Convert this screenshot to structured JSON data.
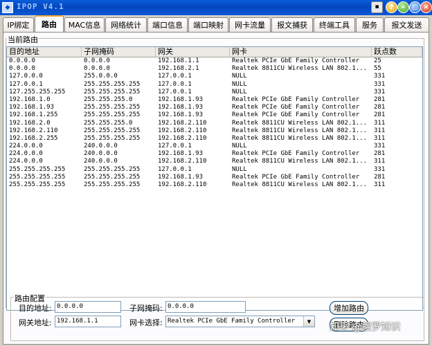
{
  "window": {
    "title": "IPOP V4.1",
    "help_glyph": "?",
    "min_glyph": "–",
    "max_glyph": "□",
    "close_glyph": "×",
    "menu_glyph": "▪"
  },
  "tabs": [
    {
      "label": "IP绑定",
      "active": false
    },
    {
      "label": "路由",
      "active": true
    },
    {
      "label": "MAC信息",
      "active": false
    },
    {
      "label": "网络统计",
      "active": false
    },
    {
      "label": "端口信息",
      "active": false
    },
    {
      "label": "端口映射",
      "active": false
    },
    {
      "label": "网卡流量",
      "active": false
    },
    {
      "label": "报文捕获",
      "active": false
    },
    {
      "label": "终端工具",
      "active": false
    },
    {
      "label": "服务",
      "active": false
    },
    {
      "label": "报文发送",
      "active": false
    }
  ],
  "route_table": {
    "group_label": "当前路由",
    "columns": [
      "目的地址",
      "子网掩码",
      "网关",
      "网卡",
      "跃点数"
    ],
    "rows": [
      [
        "0.0.0.0",
        "0.0.0.0",
        "192.168.1.1",
        "Realtek PCIe GbE Family Controller",
        "25"
      ],
      [
        "0.0.0.0",
        "0.0.0.0",
        "192.168.2.1",
        "Realtek 8811CU Wireless LAN 802.1...",
        "55"
      ],
      [
        "127.0.0.0",
        "255.0.0.0",
        "127.0.0.1",
        "NULL",
        "331"
      ],
      [
        "127.0.0.1",
        "255.255.255.255",
        "127.0.0.1",
        "NULL",
        "331"
      ],
      [
        "127.255.255.255",
        "255.255.255.255",
        "127.0.0.1",
        "NULL",
        "331"
      ],
      [
        "192.168.1.0",
        "255.255.255.0",
        "192.168.1.93",
        "Realtek PCIe GbE Family Controller",
        "281"
      ],
      [
        "192.168.1.93",
        "255.255.255.255",
        "192.168.1.93",
        "Realtek PCIe GbE Family Controller",
        "281"
      ],
      [
        "192.168.1.255",
        "255.255.255.255",
        "192.168.1.93",
        "Realtek PCIe GbE Family Controller",
        "281"
      ],
      [
        "192.168.2.0",
        "255.255.255.0",
        "192.168.2.110",
        "Realtek 8811CU Wireless LAN 802.1...",
        "311"
      ],
      [
        "192.168.2.110",
        "255.255.255.255",
        "192.168.2.110",
        "Realtek 8811CU Wireless LAN 802.1...",
        "311"
      ],
      [
        "192.168.2.255",
        "255.255.255.255",
        "192.168.2.110",
        "Realtek 8811CU Wireless LAN 802.1...",
        "311"
      ],
      [
        "224.0.0.0",
        "240.0.0.0",
        "127.0.0.1",
        "NULL",
        "331"
      ],
      [
        "224.0.0.0",
        "240.0.0.0",
        "192.168.1.93",
        "Realtek PCIe GbE Family Controller",
        "281"
      ],
      [
        "224.0.0.0",
        "240.0.0.0",
        "192.168.2.110",
        "Realtek 8811CU Wireless LAN 802.1...",
        "311"
      ],
      [
        "255.255.255.255",
        "255.255.255.255",
        "127.0.0.1",
        "NULL",
        "331"
      ],
      [
        "255.255.255.255",
        "255.255.255.255",
        "192.168.1.93",
        "Realtek PCIe GbE Family Controller",
        "281"
      ],
      [
        "255.255.255.255",
        "255.255.255.255",
        "192.168.2.110",
        "Realtek 8811CU Wireless LAN 802.1...",
        "311"
      ]
    ]
  },
  "route_config": {
    "group_label": "路由配置",
    "dest_label": "目的地址:",
    "dest_value": "0.0.0.0",
    "mask_label": "子网掩码:",
    "mask_value": "0.0.0.0",
    "gateway_label": "网关地址:",
    "gateway_value": "192.168.1.1",
    "nic_label": "网卡选择:",
    "nic_value": "Realtek PCIe GbE Family Controller",
    "add_button": "增加路由",
    "delete_button": "删除路由"
  },
  "watermark": "知乎 @搜罗知识"
}
